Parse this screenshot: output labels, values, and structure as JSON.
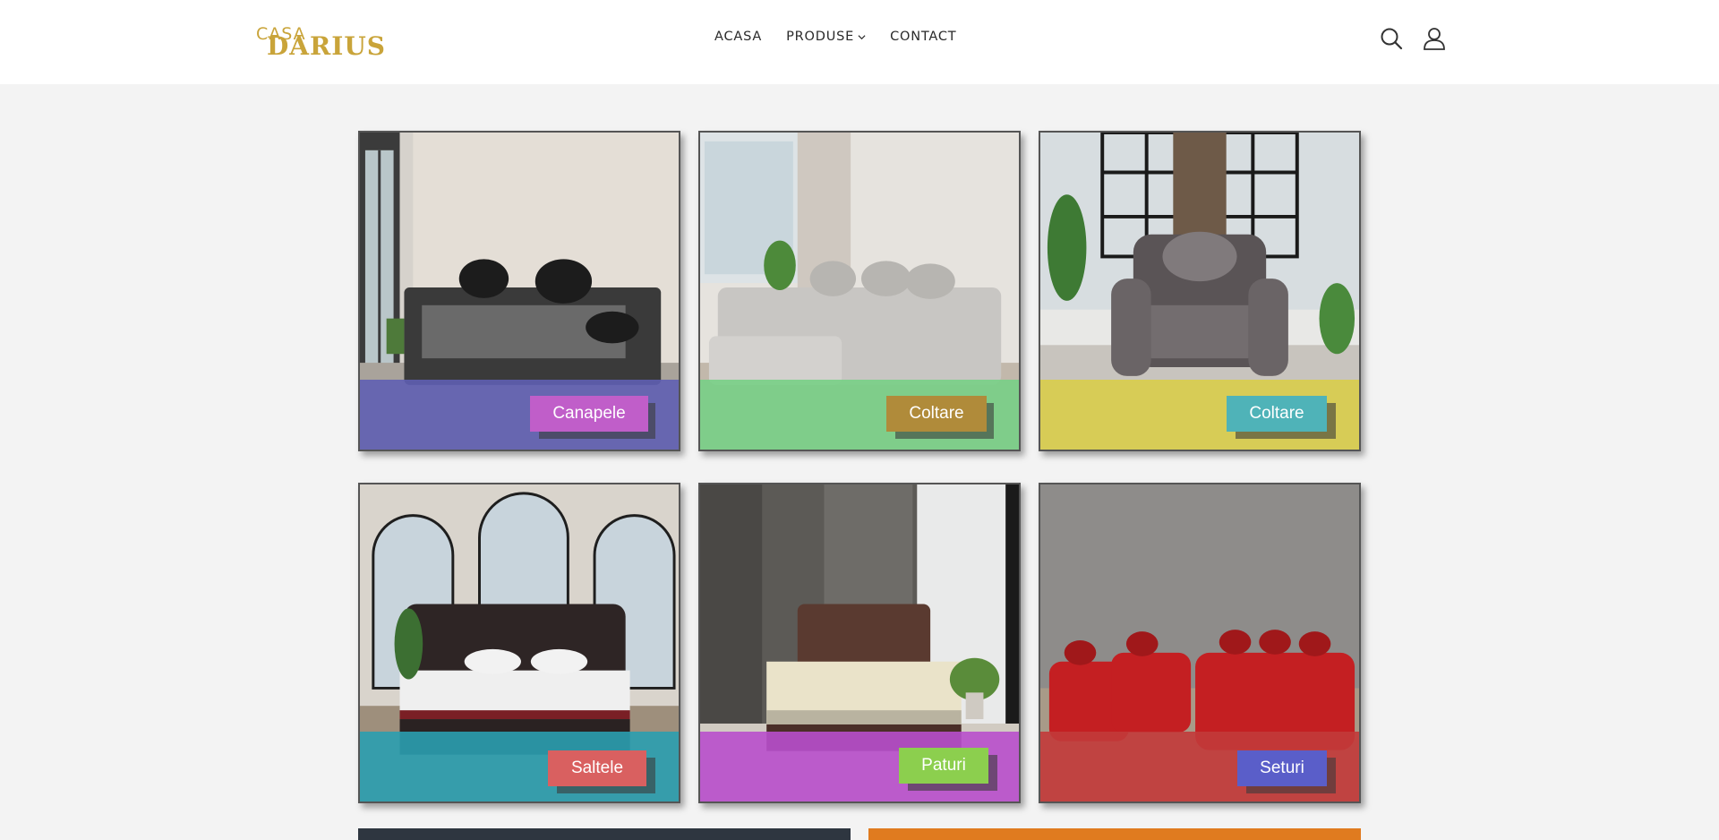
{
  "header": {
    "logo_top": "CASA",
    "logo_main": "DARIUS",
    "nav": [
      {
        "label": "ACASA"
      },
      {
        "label": "PRODUSE"
      },
      {
        "label": "CONTACT"
      }
    ],
    "icons": [
      "search-icon",
      "account-icon"
    ]
  },
  "categories": [
    {
      "label": "Canapele",
      "band_color": "#5f5fb3",
      "label_color": "#c05ec9"
    },
    {
      "label": "Coltare",
      "band_color": "#78cf86",
      "label_color": "#b08b3a"
    },
    {
      "label": "Coltare",
      "band_color": "#d8cd4a",
      "label_color": "#4fb3b8"
    },
    {
      "label": "Saltele",
      "band_color": "#2a9fb0",
      "label_color": "#d96060"
    },
    {
      "label": "Paturi",
      "band_color": "#b84fcc",
      "label_color": "#8ccf4e"
    },
    {
      "label": "Seturi",
      "band_color": "#c23a3a",
      "label_color": "#5a5ec9"
    }
  ],
  "colors": {
    "brand_gold": "#c9a43a",
    "bottom_left": "#2e3640",
    "bottom_right": "#e07b1f"
  }
}
